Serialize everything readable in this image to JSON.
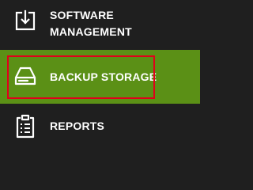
{
  "nav": {
    "items": [
      {
        "key": "software-management",
        "label_lines": [
          "SOFTWARE",
          "MANAGEMENT"
        ],
        "icon": "download-tray-icon",
        "active": false
      },
      {
        "key": "backup-storage",
        "label": "BACKUP STORAGE",
        "icon": "drive-icon",
        "active": true
      },
      {
        "key": "reports",
        "label": "REPORTS",
        "icon": "clipboard-icon",
        "active": false
      }
    ]
  },
  "colors": {
    "background": "#1f1f1f",
    "active_background": "#5b9016",
    "text": "#ffffff",
    "highlight_border": "#e0001b"
  }
}
